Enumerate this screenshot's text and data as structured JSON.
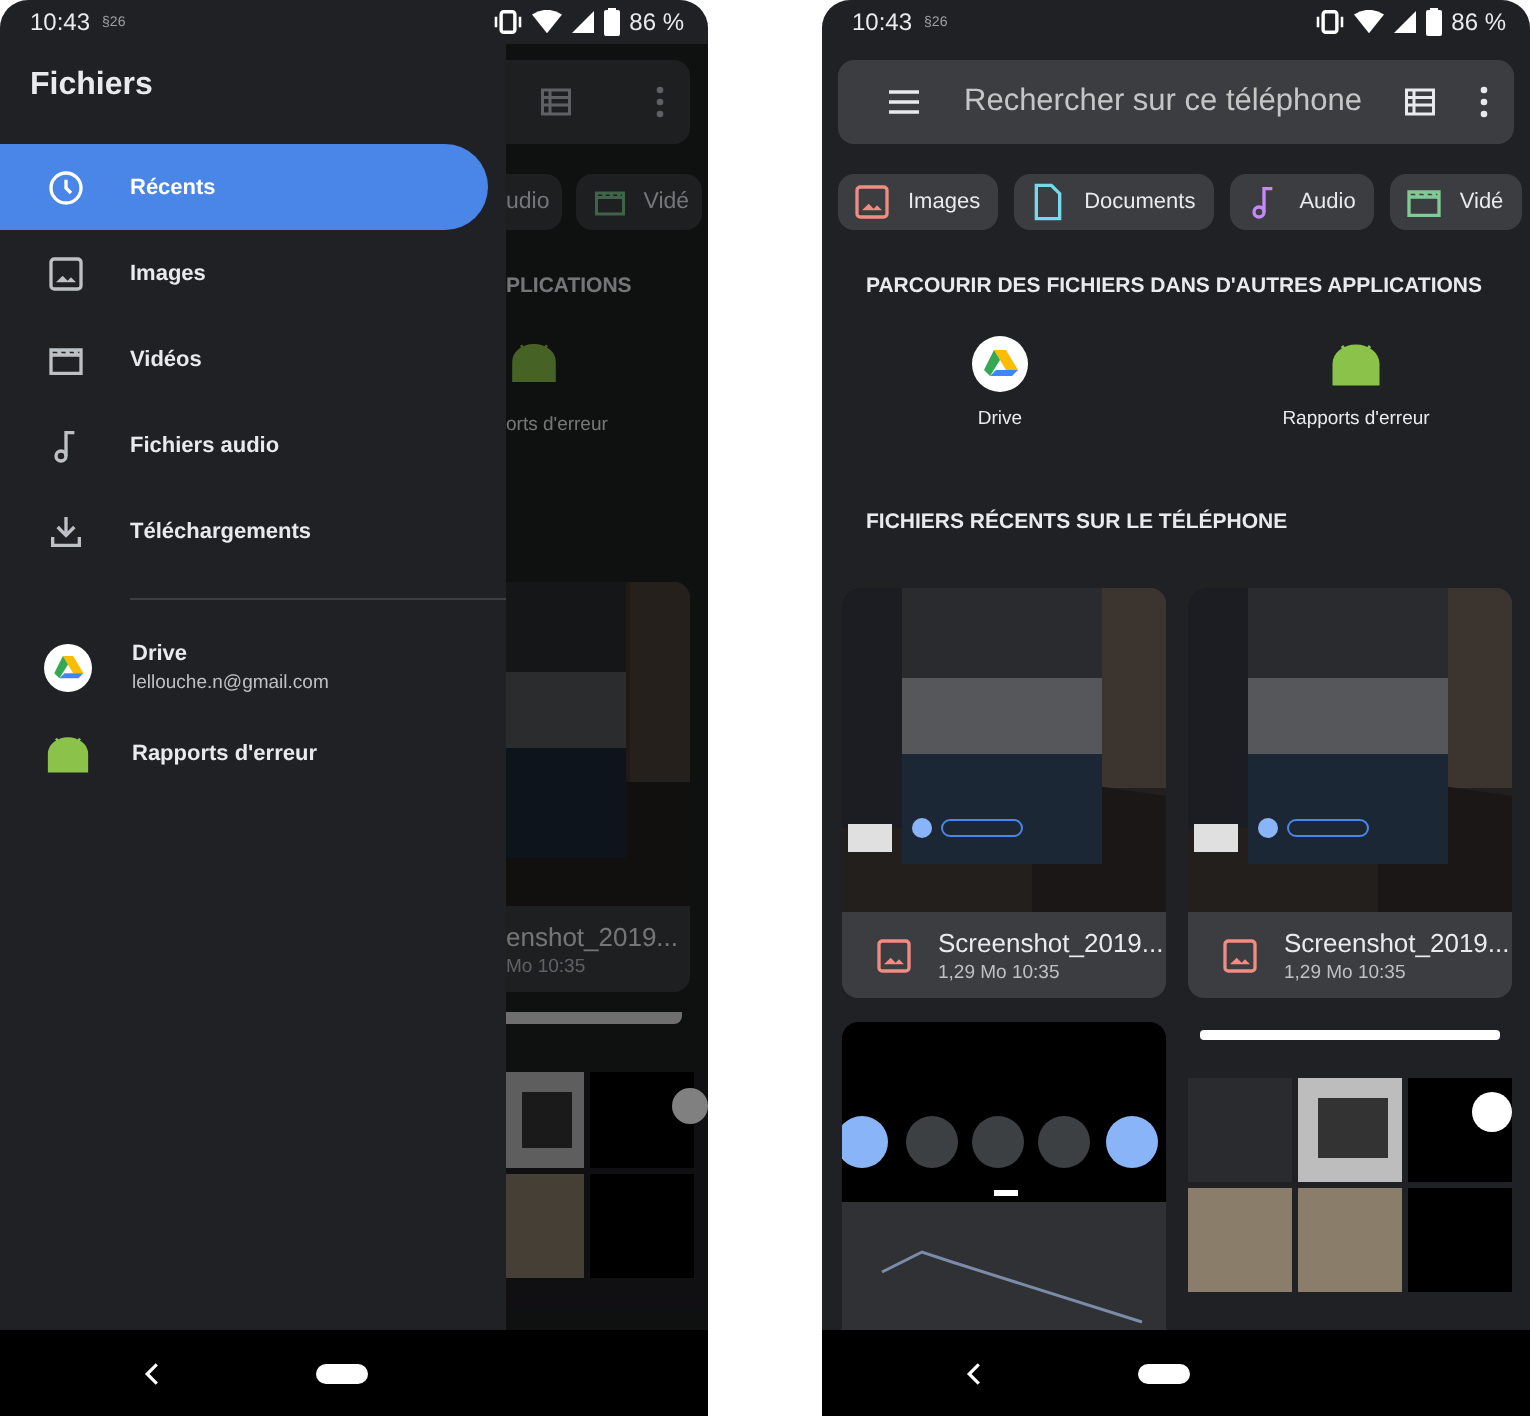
{
  "left_screen": {
    "status_bar": {
      "time": "10:43",
      "notification": "§26",
      "battery": "86 %"
    },
    "drawer": {
      "title": "Fichiers",
      "items": [
        {
          "label": "Récents",
          "selected": true
        },
        {
          "label": "Images",
          "selected": false
        },
        {
          "label": "Vidéos",
          "selected": false
        },
        {
          "label": "Fichiers audio",
          "selected": false
        },
        {
          "label": "Téléchargements",
          "selected": false
        }
      ],
      "sources": [
        {
          "label": "Drive",
          "subtitle": "lellouche.n@gmail.com"
        },
        {
          "label": "Rapports d'erreur"
        }
      ]
    },
    "background": {
      "chips": [
        {
          "label": "udio"
        },
        {
          "label": "Vidé",
          "color": "#40644a"
        }
      ],
      "section_heading": "PLICATIONS",
      "app_label": "orts d'erreur",
      "card": {
        "title": "enshot_2019...",
        "subtitle": "Mo 10:35"
      }
    }
  },
  "right_screen": {
    "status_bar": {
      "time": "10:43",
      "notification": "§26",
      "battery": "86 %"
    },
    "search": {
      "placeholder": "Rechercher sur ce téléphone"
    },
    "chips": [
      {
        "label": "Images",
        "color": "#f28b82"
      },
      {
        "label": "Documents",
        "color": "#78d9ec"
      },
      {
        "label": "Audio",
        "color": "#c58af9"
      },
      {
        "label": "Vidé",
        "color": "#81c995"
      }
    ],
    "apps_section": {
      "heading": "PARCOURIR DES FICHIERS DANS D'AUTRES APPLICATIONS",
      "apps": [
        {
          "label": "Drive"
        },
        {
          "label": "Rapports d'erreur"
        }
      ]
    },
    "recent_section": {
      "heading": "FICHIERS RÉCENTS SUR LE TÉLÉPHONE",
      "files": [
        {
          "title": "Screenshot_2019...",
          "subtitle": "1,29 Mo 10:35"
        },
        {
          "title": "Screenshot_2019...",
          "subtitle": "1,29 Mo 10:35"
        }
      ]
    }
  }
}
